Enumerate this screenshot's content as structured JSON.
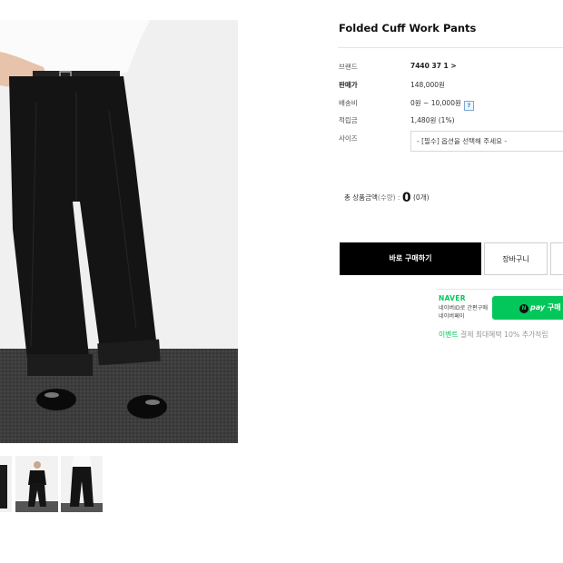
{
  "product": {
    "title": "Folded Cuff Work Pants"
  },
  "info": {
    "brand_label": "브랜드",
    "brand_value": "7440 37 1 >",
    "price_label": "판매가",
    "price_value": "148,000원",
    "shipping_label": "배송비",
    "shipping_value": "0원 ~ 10,000원",
    "shipping_help": "?",
    "points_label": "적립금",
    "points_value": "1,480원 (1%)",
    "size_label": "사이즈",
    "size_select": "- [필수] 옵션을 선택해 주세요 -"
  },
  "total": {
    "label": "총 상품금액",
    "qty_label": "(수량) :",
    "amount": "0",
    "count": "(0개)"
  },
  "buttons": {
    "buy": "바로 구매하기",
    "cart": "장바구니"
  },
  "naver": {
    "logo": "NAVER",
    "desc_line1": "네이버ID로 간편구매",
    "desc_line2": "네이버페이",
    "pay_icon": "N",
    "pay_label": "pay",
    "pay_action": "구매",
    "event_highlight": "이벤트",
    "event_text": "결제 최대혜택 10% 추가적립"
  },
  "icons": {
    "help": "question-mark-icon"
  },
  "colors": {
    "buy_button": "#000000",
    "naver_green": "#03c75a"
  }
}
